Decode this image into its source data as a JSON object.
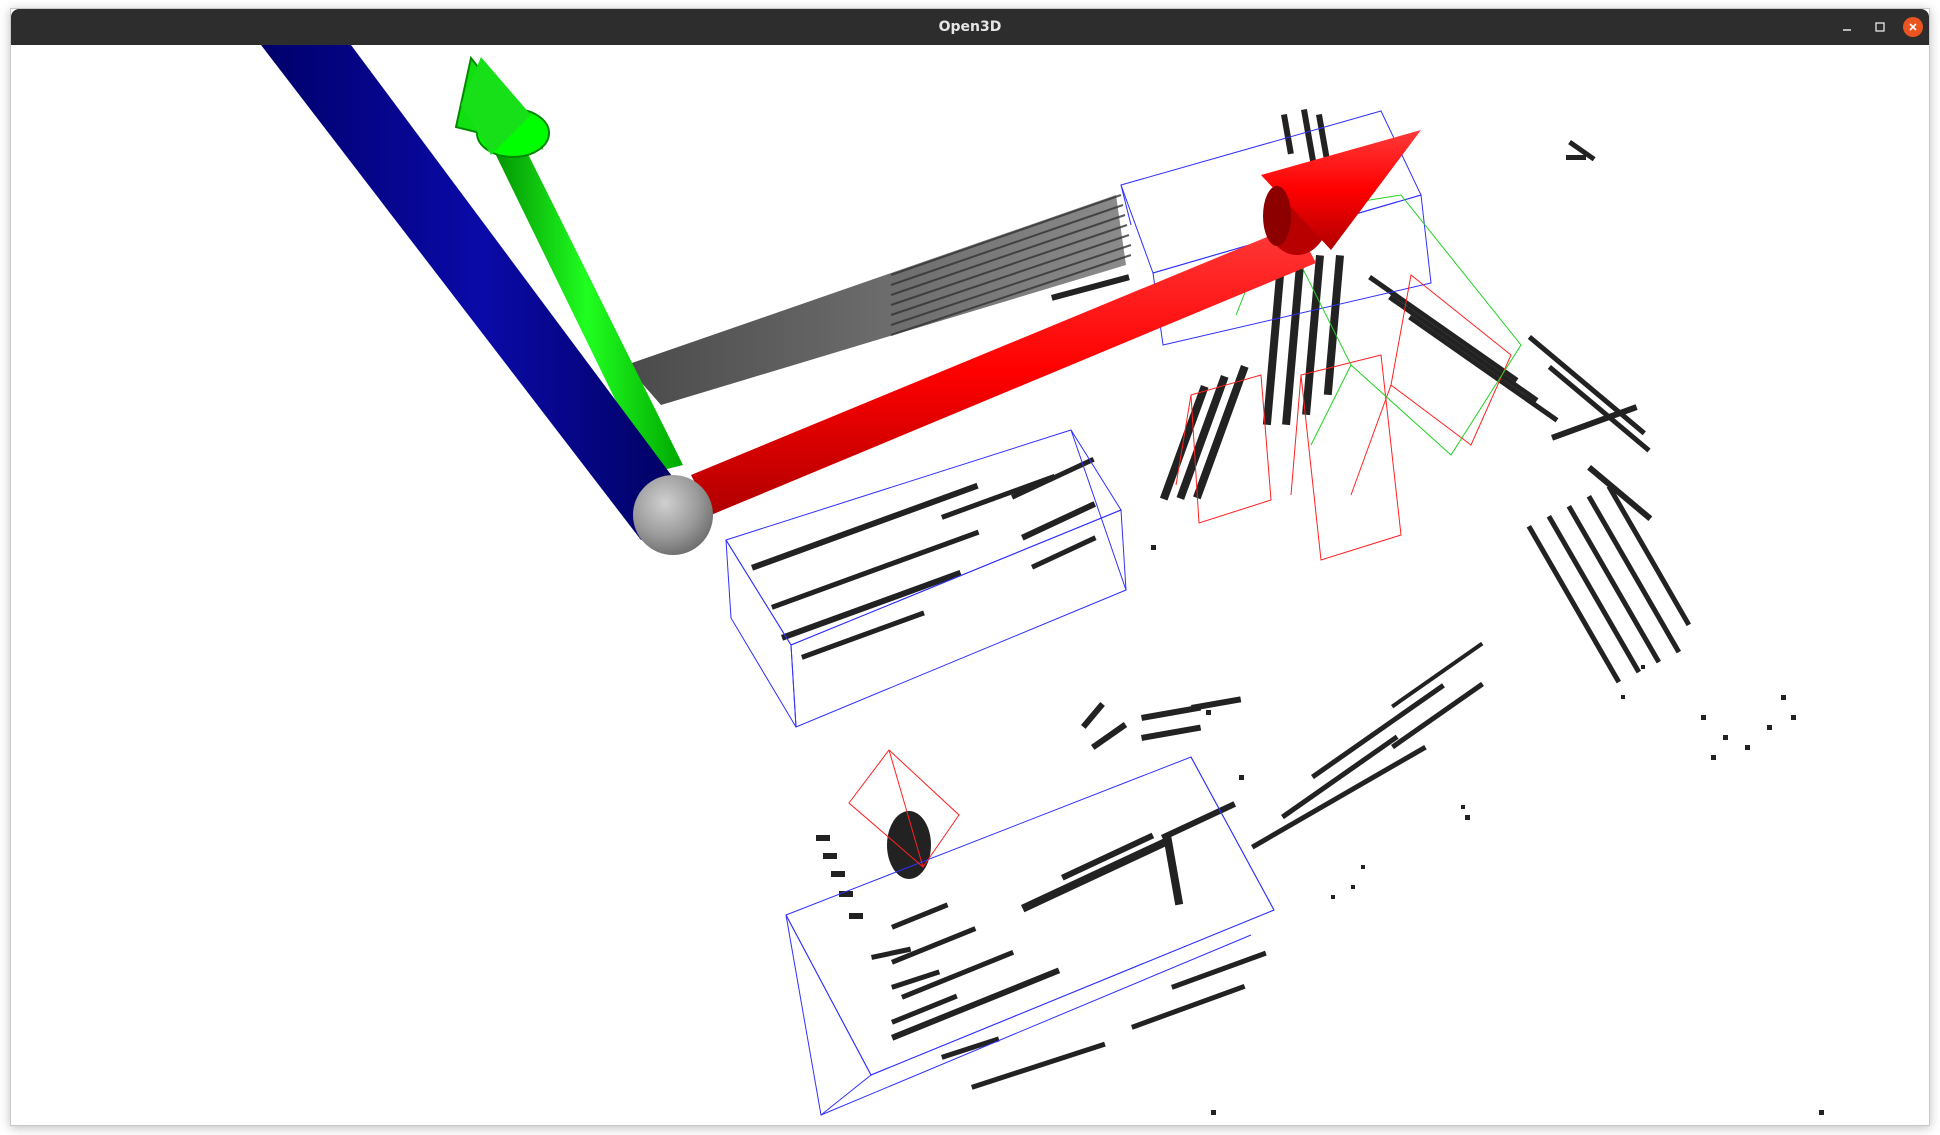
{
  "window": {
    "title": "Open3D"
  },
  "titlebar_buttons": [
    {
      "name": "minimize-button",
      "icon": "minimize-icon"
    },
    {
      "name": "maximize-button",
      "icon": "maximize-icon"
    },
    {
      "name": "close-button",
      "icon": "close-icon"
    }
  ],
  "colors": {
    "titlebar": "#2d2d2d",
    "title_text": "#e6e6e6",
    "close_button": "#e95420",
    "x_axis": "#ff0000",
    "y_axis": "#00e000",
    "z_axis": "#000099",
    "origin_sphere": "#a0a0a0",
    "box_vehicle": "#3030ff",
    "box_pedestrian": "#ff2020",
    "box_cyclist": "#20d020",
    "points": "#222222"
  },
  "scene": {
    "axes": [
      {
        "name": "x-axis-arrow",
        "color": "#ff0000"
      },
      {
        "name": "y-axis-arrow",
        "color": "#00e000"
      },
      {
        "name": "z-axis-arrow",
        "color": "#000099"
      }
    ],
    "bounding_boxes": [
      {
        "name": "vehicle-box-1",
        "class_color": "#3030ff"
      },
      {
        "name": "vehicle-box-2",
        "class_color": "#3030ff"
      },
      {
        "name": "vehicle-box-3",
        "class_color": "#3030ff"
      },
      {
        "name": "pedestrian-box-1",
        "class_color": "#ff2020"
      },
      {
        "name": "pedestrian-box-2",
        "class_color": "#ff2020"
      },
      {
        "name": "pedestrian-box-3",
        "class_color": "#ff2020"
      },
      {
        "name": "pedestrian-box-4",
        "class_color": "#ff2020"
      },
      {
        "name": "cyclist-box-1",
        "class_color": "#20d020"
      }
    ]
  }
}
